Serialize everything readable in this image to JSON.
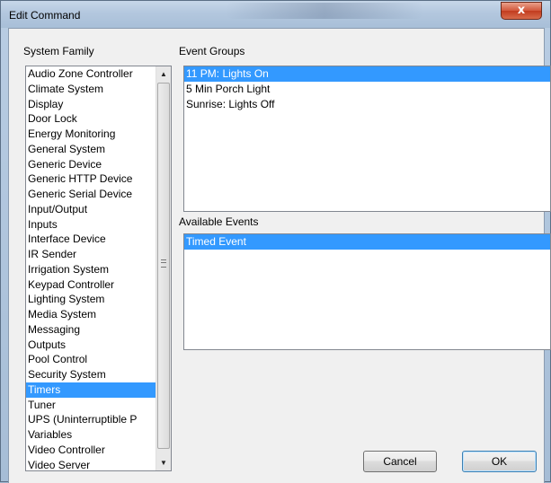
{
  "window": {
    "title": "Edit Command",
    "close_glyph": "x"
  },
  "system_family": {
    "label": "System Family",
    "items": [
      "Audio Zone Controller",
      "Climate System",
      "Display",
      "Door Lock",
      "Energy Monitoring",
      "General System",
      "Generic Device",
      "Generic HTTP Device",
      "Generic Serial Device",
      "Input/Output",
      "Inputs",
      "Interface Device",
      "IR Sender",
      "Irrigation System",
      "Keypad Controller",
      "Lighting System",
      "Media System",
      "Messaging",
      "Outputs",
      "Pool Control",
      "Security System",
      "Timers",
      "Tuner",
      "UPS (Uninterruptible P",
      "Variables",
      "Video Controller",
      "Video Server"
    ],
    "selected": "Timers"
  },
  "event_groups": {
    "label": "Event Groups",
    "items": [
      "11 PM: Lights On",
      "5 Min Porch Light",
      "Sunrise: Lights Off"
    ],
    "selected": "11 PM: Lights On"
  },
  "available_events": {
    "label": "Available Events",
    "items": [
      "Timed Event"
    ],
    "selected": "Timed Event"
  },
  "buttons": {
    "cancel": "Cancel",
    "ok": "OK"
  }
}
